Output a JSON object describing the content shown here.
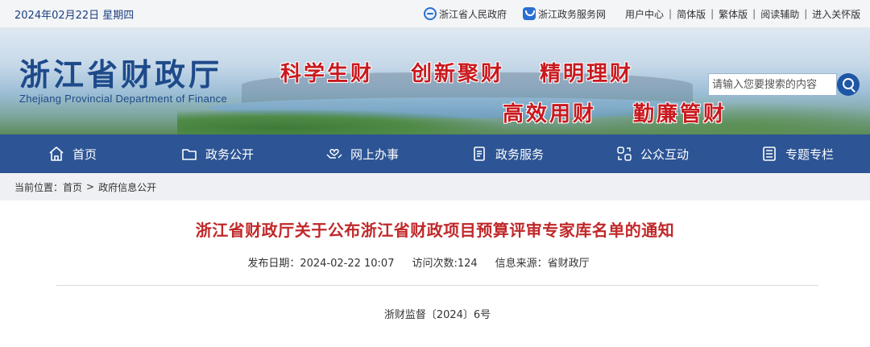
{
  "topbar": {
    "date": "2024年02月22日 星期四",
    "links": [
      {
        "label": "浙江省人民政府",
        "icon": "provincial-gov-icon"
      },
      {
        "label": "浙江政务服务网",
        "icon": "gov-service-icon"
      }
    ],
    "utilities": [
      "用户中心",
      "简体版",
      "繁体版",
      "阅读辅助",
      "进入关怀版"
    ]
  },
  "header": {
    "title_cn": "浙江省财政厅",
    "title_en": "Zhejiang Provincial Department of Finance",
    "slogans": [
      "科学生财",
      "创新聚财",
      "精明理财",
      "高效用财",
      "勤廉管财"
    ],
    "search": {
      "placeholder": "请输入您要搜索的内容"
    }
  },
  "nav": {
    "items": [
      {
        "label": "首页",
        "icon": "home-icon"
      },
      {
        "label": "政务公开",
        "icon": "folder-icon"
      },
      {
        "label": "网上办事",
        "icon": "hands-heart-icon"
      },
      {
        "label": "政务服务",
        "icon": "document-icon"
      },
      {
        "label": "公众互动",
        "icon": "interaction-icon"
      },
      {
        "label": "专题专栏",
        "icon": "list-document-icon"
      }
    ]
  },
  "breadcrumb": {
    "prefix": "当前位置：",
    "items": [
      "首页",
      "政府信息公开"
    ],
    "separator": ">"
  },
  "article": {
    "title": "浙江省财政厅关于公布浙江省财政项目预算评审专家库名单的通知",
    "publish_date": "发布日期：2024-02-22 10:07",
    "views": "访问次数:124",
    "source": "信息来源：省财政厅",
    "doc_number": "浙财监督〔2024〕6号"
  },
  "colors": {
    "nav_bg": "#2d5595",
    "title_red": "#c0282a",
    "slogan_red": "#c9191e",
    "brand_blue": "#1e4a8a"
  }
}
